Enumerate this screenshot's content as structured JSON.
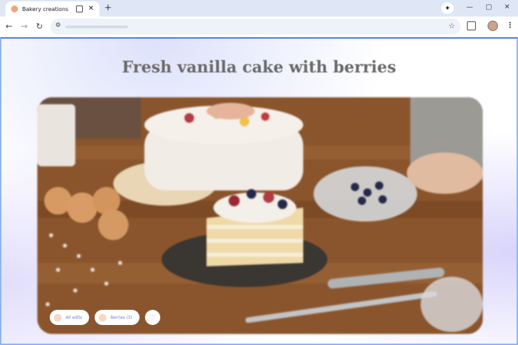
{
  "browser": {
    "tab_title": "Bakery creations",
    "new_tab_glyph": "+",
    "close_glyph": "✕",
    "minimize_glyph": "—",
    "maximize_glyph": "▢",
    "window_close_glyph": "✕",
    "spark_glyph": "✦",
    "back_glyph": "←",
    "forward_glyph": "→",
    "reload_glyph": "↻",
    "star_glyph": "☆",
    "menu_glyph": "⋮"
  },
  "page": {
    "heading": "Fresh vanilla cake with berries",
    "chips": [
      {
        "label": "All edits"
      },
      {
        "label": "Berries (5)"
      }
    ],
    "favorite_glyph": "♡"
  },
  "icons": [
    "favicon-icon",
    "share-icon",
    "new-tab-icon",
    "spark-icon",
    "back-icon",
    "forward-icon",
    "reload-icon",
    "tune-icon",
    "star-icon",
    "extensions-icon",
    "profile-avatar",
    "menu-icon",
    "heart-icon"
  ]
}
